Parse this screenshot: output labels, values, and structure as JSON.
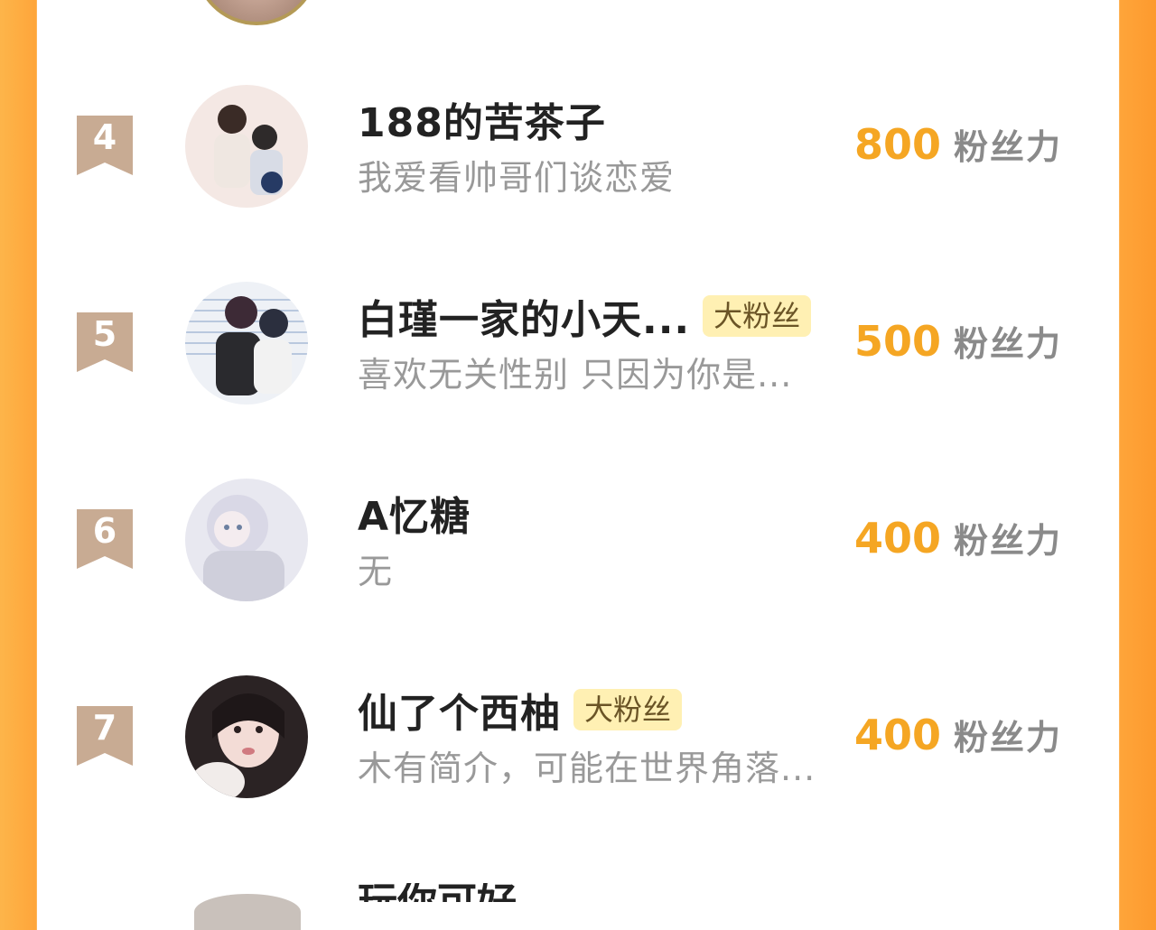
{
  "colors": {
    "accent_orange": "#f5a623",
    "border_orange": "#fea53a",
    "rank_badge": "#c8ab93",
    "tag_bg": "#fff0b3"
  },
  "rows": [
    {
      "rank": "4",
      "name": "188的苦茶子",
      "tag": "",
      "bio": "我爱看帅哥们谈恋爱",
      "score": "800",
      "unit": "粉丝力"
    },
    {
      "rank": "5",
      "name": "白瑾一家的小天...",
      "tag": "大粉丝",
      "bio": "喜欢无关性别 只因为你是...",
      "score": "500",
      "unit": "粉丝力"
    },
    {
      "rank": "6",
      "name": "A忆糖",
      "tag": "",
      "bio": "无",
      "score": "400",
      "unit": "粉丝力"
    },
    {
      "rank": "7",
      "name": "仙了个西柚",
      "tag": "大粉丝",
      "bio": "木有简介，可能在世界角落...",
      "score": "400",
      "unit": "粉丝力"
    }
  ],
  "partial_next": {
    "name": "玩你可好"
  }
}
